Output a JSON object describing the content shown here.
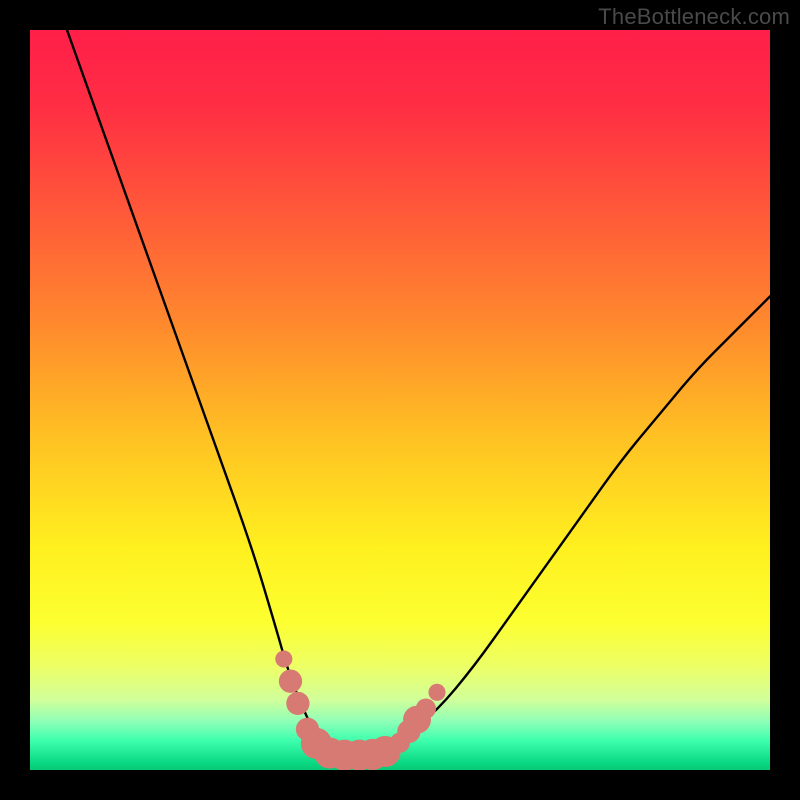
{
  "watermark": "TheBottleneck.com",
  "chart_data": {
    "type": "line",
    "title": "",
    "xlabel": "",
    "ylabel": "",
    "xlim": [
      0,
      100
    ],
    "ylim": [
      0,
      100
    ],
    "series": [
      {
        "name": "bottleneck-curve",
        "x": [
          5,
          10,
          15,
          20,
          25,
          30,
          33,
          35,
          37,
          39,
          41,
          43,
          45,
          47,
          50,
          55,
          60,
          65,
          70,
          75,
          80,
          85,
          90,
          95,
          100
        ],
        "y": [
          100,
          86,
          72,
          58,
          44,
          30,
          20,
          13,
          8,
          4,
          2.5,
          2,
          2,
          2.5,
          4,
          8,
          14,
          21,
          28,
          35,
          42,
          48,
          54,
          59,
          64
        ]
      }
    ],
    "markers": {
      "name": "highlight-points",
      "color": "#d87a74",
      "points": [
        {
          "x": 34.3,
          "y": 15.0,
          "r": 1.1
        },
        {
          "x": 35.2,
          "y": 12.0,
          "r": 1.5
        },
        {
          "x": 36.2,
          "y": 9.0,
          "r": 1.5
        },
        {
          "x": 37.5,
          "y": 5.5,
          "r": 1.5
        },
        {
          "x": 38.7,
          "y": 3.6,
          "r": 2.0
        },
        {
          "x": 40.5,
          "y": 2.3,
          "r": 2.0
        },
        {
          "x": 42.5,
          "y": 2.0,
          "r": 2.0
        },
        {
          "x": 44.5,
          "y": 2.0,
          "r": 2.0
        },
        {
          "x": 46.3,
          "y": 2.1,
          "r": 2.0
        },
        {
          "x": 48.0,
          "y": 2.5,
          "r": 2.0
        },
        {
          "x": 50.0,
          "y": 3.7,
          "r": 1.3
        },
        {
          "x": 51.2,
          "y": 5.2,
          "r": 1.5
        },
        {
          "x": 52.3,
          "y": 6.8,
          "r": 1.8
        },
        {
          "x": 53.5,
          "y": 8.3,
          "r": 1.3
        },
        {
          "x": 55.0,
          "y": 10.5,
          "r": 1.1
        }
      ]
    },
    "gradient_stops": [
      {
        "offset": 0.0,
        "color": "#ff1f49"
      },
      {
        "offset": 0.1,
        "color": "#ff2d44"
      },
      {
        "offset": 0.25,
        "color": "#ff5a39"
      },
      {
        "offset": 0.4,
        "color": "#ff8a2d"
      },
      {
        "offset": 0.55,
        "color": "#ffc123"
      },
      {
        "offset": 0.7,
        "color": "#fff01f"
      },
      {
        "offset": 0.8,
        "color": "#fcff30"
      },
      {
        "offset": 0.86,
        "color": "#edff66"
      },
      {
        "offset": 0.905,
        "color": "#d1ff9a"
      },
      {
        "offset": 0.935,
        "color": "#8dffb8"
      },
      {
        "offset": 0.96,
        "color": "#3effad"
      },
      {
        "offset": 0.99,
        "color": "#0bd983"
      },
      {
        "offset": 1.0,
        "color": "#07c974"
      }
    ]
  }
}
